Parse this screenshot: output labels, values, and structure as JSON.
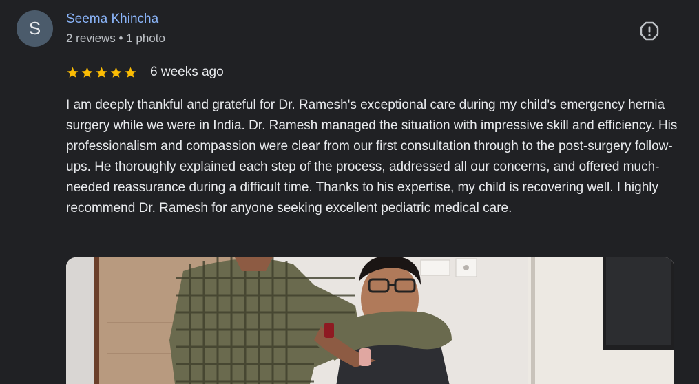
{
  "reviewer": {
    "initial": "S",
    "name": "Seema Khincha",
    "meta": "2 reviews • 1 photo"
  },
  "review": {
    "rating": 5,
    "rating_max": 5,
    "time_ago": "6 weeks ago",
    "text": "I am deeply thankful and grateful for Dr. Ramesh's exceptional care during my child's emergency hernia surgery while we were in India. Dr. Ramesh managed the situation with impressive skill and efficiency. His professionalism and compassion were clear from our first consultation through to the post-surgery follow-ups. He thoroughly explained each step of the process, addressed all our concerns, and offered much-needed reassurance during a difficult time. Thanks to his expertise, my child is recovering well. I highly recommend Dr. Ramesh for anyone seeking excellent pediatric medical care."
  },
  "colors": {
    "background": "#202124",
    "name_link": "#8ab4f8",
    "star": "#fbbc04",
    "avatar_bg": "#4b5b6b"
  },
  "icons": {
    "report": "report-icon",
    "star": "star-icon"
  }
}
